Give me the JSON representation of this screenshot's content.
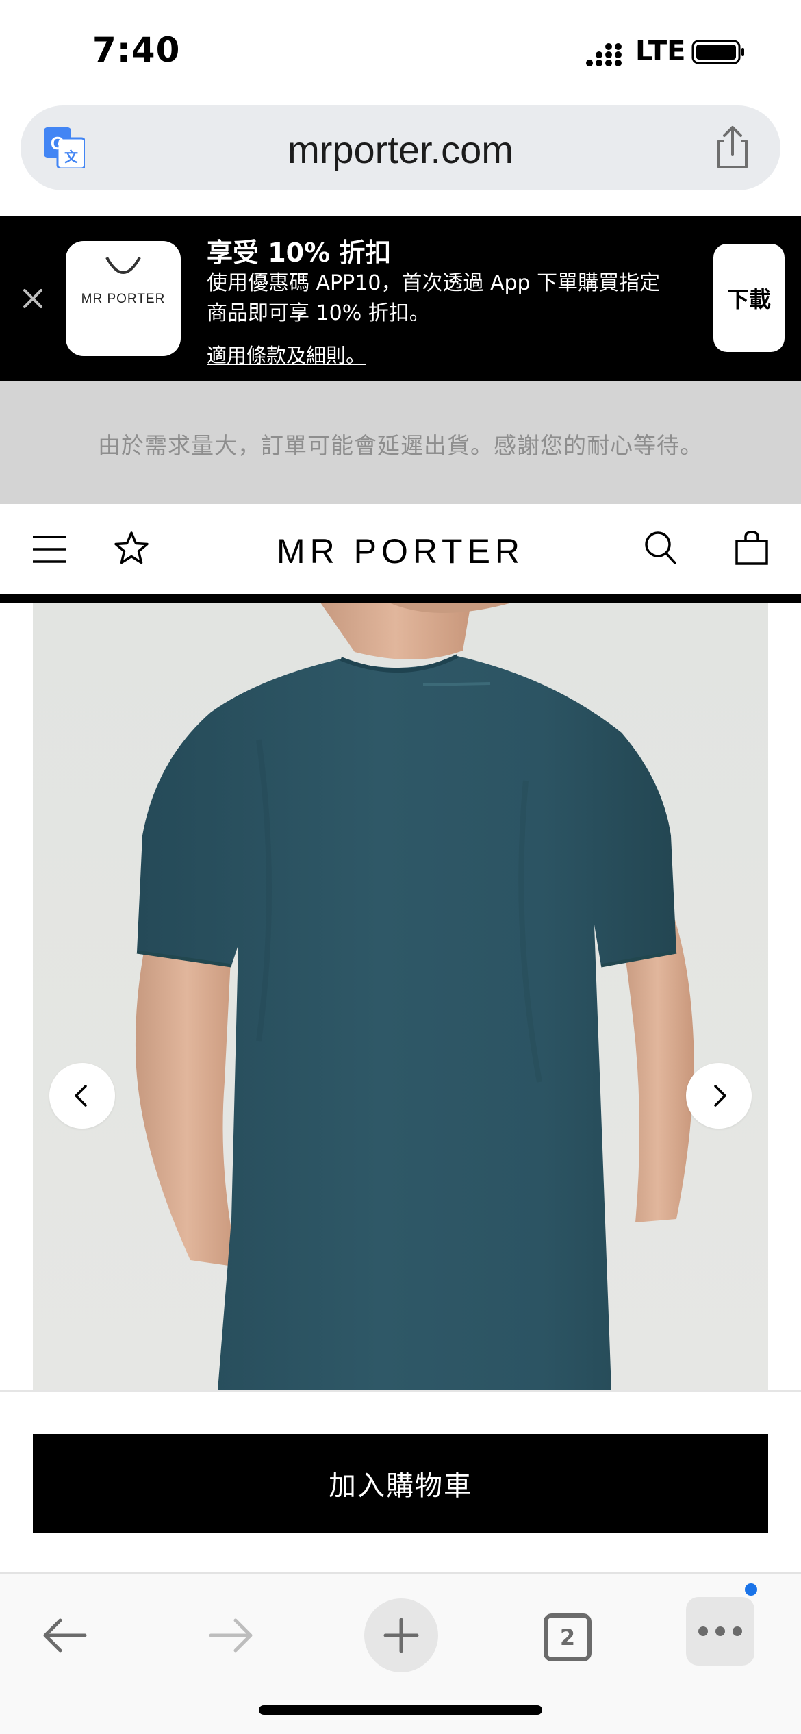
{
  "status_bar": {
    "time": "7:40",
    "network": "LTE"
  },
  "browser": {
    "url": "mrporter.com",
    "tab_count": "2"
  },
  "promo": {
    "app_name": "MR PORTER",
    "title": "享受 10% 折扣",
    "body": "使用優惠碼 APP10，首次透過 App 下單購買指定商品即可享 10% 折扣。",
    "terms_link": "適用條款及細則。",
    "download_label": "下載"
  },
  "notice": {
    "text": "由於需求量大，訂單可能會延遲出貨。感謝您的耐心等待。"
  },
  "header": {
    "brand": "MR PORTER"
  },
  "product": {
    "image_alt": "Men's teal short-sleeve T-shirt, back view"
  },
  "cart": {
    "add_to_cart_label": "加入購物車"
  },
  "colors": {
    "shirt": "#2e5564",
    "accent_dot": "#1a73e8",
    "notice_bg": "#d4d4d4"
  }
}
